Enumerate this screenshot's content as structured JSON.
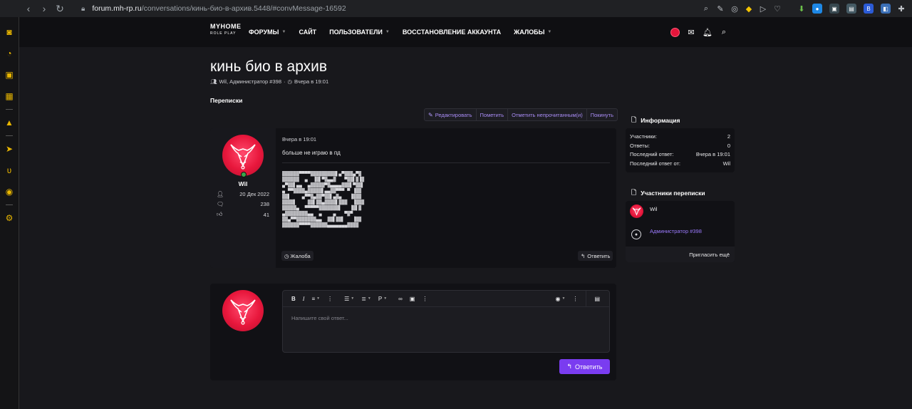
{
  "browser": {
    "url_host": "forum.mh-rp.ru",
    "url_path": "/conversations/кинь-био-в-архив.5448/#convMessage-16592"
  },
  "header": {
    "logo_main": "MYHOME",
    "logo_sub": "ROLE PLAY",
    "nav": [
      {
        "label": "ФОРУМЫ",
        "has_caret": true
      },
      {
        "label": "САЙТ",
        "has_caret": false
      },
      {
        "label": "ПОЛЬЗОВАТЕЛИ",
        "has_caret": true
      },
      {
        "label": "ВОССТАНОВЛЕНИЕ АККАУНТА",
        "has_caret": false
      },
      {
        "label": "ЖАЛОБЫ",
        "has_caret": true
      }
    ]
  },
  "conversation": {
    "title": "кинь био в архив",
    "meta_participants": "Wil, Администратор #398",
    "meta_sep": "·",
    "meta_time": "Вчера в 19:01",
    "breadcrumb": "Переписки",
    "actions": [
      "Редактировать",
      "Пометить",
      "Отметить непрочитанным(и)",
      "Покинуть"
    ]
  },
  "message": {
    "author": "Wil",
    "joined": "20 Дек 2022",
    "messages": "238",
    "reactions": "41",
    "date": "Вчера в 19:01",
    "text": "больше не играю в пд",
    "ascii_art": "▓▓▓▓▓▓▀▀▀▀▓▓▓▓▓▓▓▓▓▌▄▀▓▓▓▄▀▓\n▓▓▓▓▓▓  ▄  ▐▓▌▀▓▄▄▓   ▀▓▓▌▓▐▓\n▄▀▓▓▌▄▄  ▄▓▓▓▓▓▀▓▄▄▄▄▓▓▓▌▀▓▓▌\n▄ ▀▀▓▓▓▓▄▓▓▓▓▓▌▄▄▓▓▀▀▀ ▀ ▐▓▓\n▓▓▌    ▄▀▀▓▄▓▓▀▓▓▌▄▓▄   ▐▓▓▓\n▓▓▓▓▌    ▓▓▌▓▓▄▓▓▓▓▌▓▓▓  ▐▓▓▓\n▓▓▓▓▓▄  ▀▀▀▀▀▓▓▓▓▓▓▓▌   ▐▓▌▓\n▄▓▓▓▓▓▓▓▓▄▄  ▄    ▄   ▀▓▀\n▓▓▄▀▀▓▓▓▓▓▓▓▄▄  ▓▓▌▓▓▌   ▐▓▓\n▓▓▓▓▓▓▀▀▀▀▓▓▓▓▓▓▄▄▄▄▄▄▄▓▓▓▓",
    "complain_label": "Жалоба",
    "reply_label": "Ответить"
  },
  "editor": {
    "placeholder": "Напишите свой ответ...",
    "submit_label": "Ответить"
  },
  "sidebar": {
    "info_title": "Информация",
    "info_rows": [
      {
        "label": "Участники:",
        "value": "2"
      },
      {
        "label": "Ответы:",
        "value": "0"
      },
      {
        "label": "Последний ответ:",
        "value": "Вчера в 19:01"
      },
      {
        "label": "Последний ответ от:",
        "value": "Wil"
      }
    ],
    "participants_title": "Участники переписки",
    "participants": [
      "Wil",
      "Администратор #398"
    ],
    "invite_label": "Пригласить ещё"
  },
  "colors": {
    "accent": "#7a3cf0",
    "link": "#9c7bff",
    "avatar_red": "#e8173c",
    "sidepanel_icons": "#e9b600"
  }
}
